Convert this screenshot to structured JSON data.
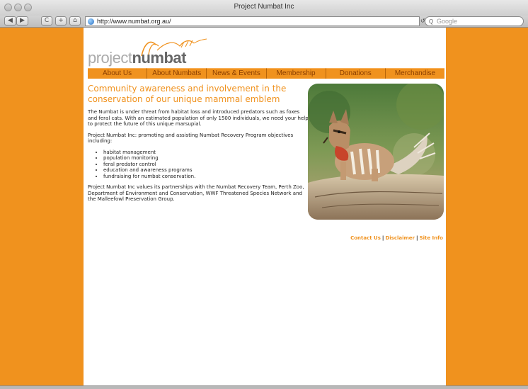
{
  "window": {
    "title": "Project Numbat Inc"
  },
  "toolbar": {
    "back_label": "◀",
    "forward_label": "▶",
    "reload_label": "C",
    "add_label": "+",
    "home_label": "⌂",
    "url": "http://www.numbat.org.au/",
    "search_placeholder": "Google"
  },
  "site": {
    "logo_a": "project",
    "logo_b": "numbat",
    "nav": [
      "About Us",
      "About Numbats",
      "News & Events",
      "Membership",
      "Donations",
      "Merchandise"
    ],
    "heading": "Community awareness and involvement in the conservation of our unique mammal emblem",
    "paragraph1": "The Numbat is under threat from habitat loss and introduced predators such as foxes and feral cats. With an estimated population of only 1500 individuals, we need your help to protect the future of this unique marsupial.",
    "paragraph2": "Project Numbat Inc: promoting and assisting Numbat Recovery Program objectives including:",
    "objectives": [
      "habitat management",
      "population monitoring",
      "feral predator control",
      "education and awareness programs",
      "fundraising for numbat conservation."
    ],
    "paragraph3": "Project Numbat Inc values its partnerships with the Numbat Recovery Team, Perth Zoo, Department of Environment and Conservation, WWF Threatened Species Network and the Malleefowl Preservation Group.",
    "footer": {
      "contact": "Contact Us",
      "disclaimer": "Disclaimer",
      "siteinfo": "Site Info",
      "separator": "|"
    }
  },
  "colors": {
    "accent": "#f0921e",
    "nav_text": "#8a3e00"
  }
}
